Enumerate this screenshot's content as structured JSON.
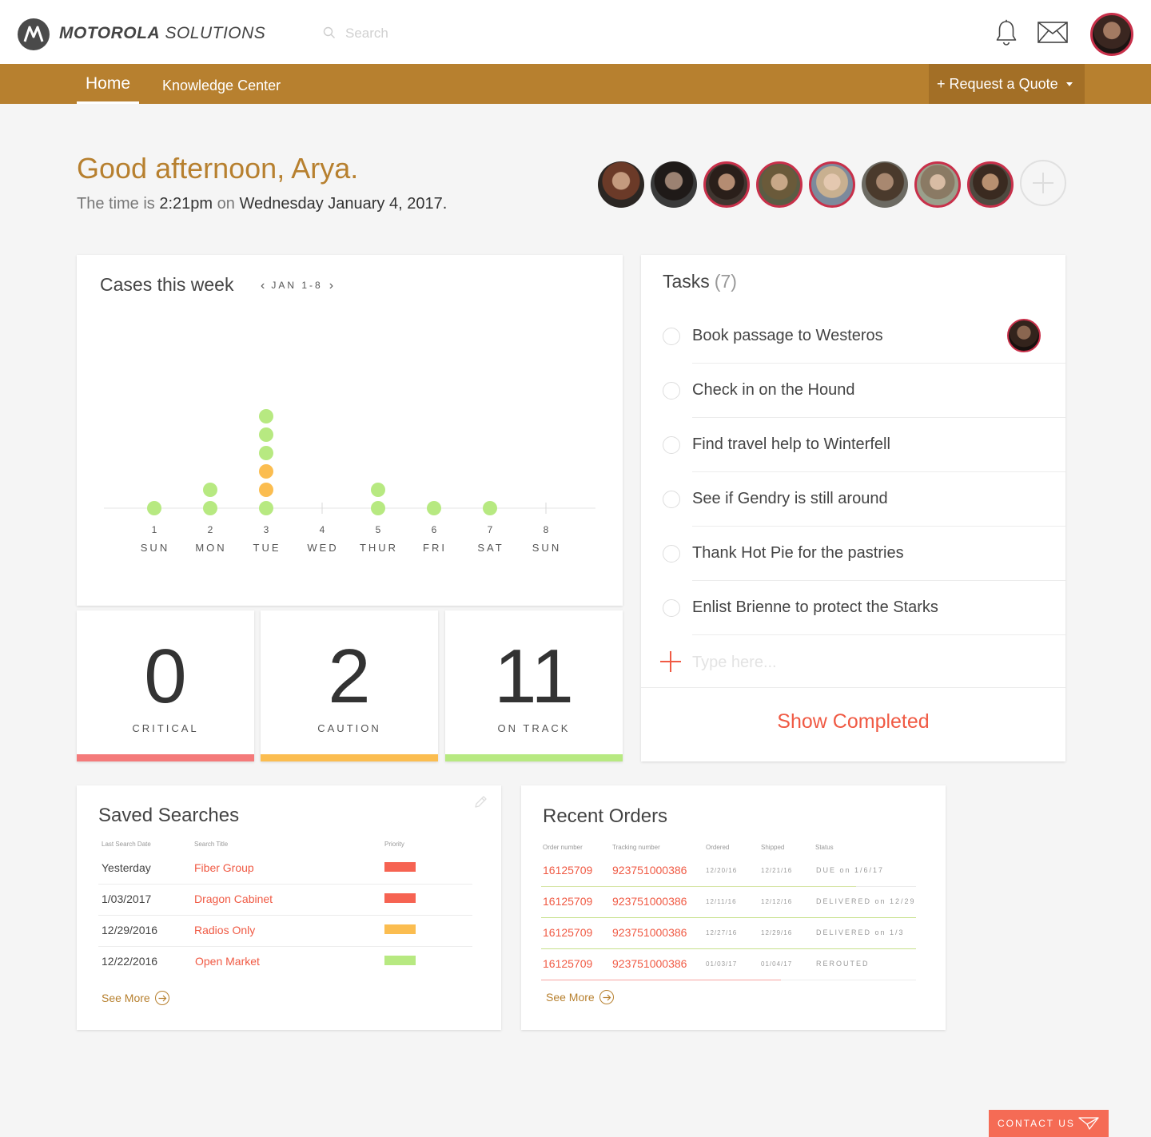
{
  "header": {
    "brand_bold": "MOTOROLA",
    "brand_light": "SOLUTIONS",
    "search_placeholder": "Search",
    "icons": [
      "motorola-logo-icon",
      "search-icon",
      "bell-icon",
      "mail-icon"
    ]
  },
  "nav": {
    "home": "Home",
    "knowledge_center": "Knowledge Center",
    "request_quote": "+ Request a Quote"
  },
  "greeting": {
    "title": "Good afternoon, Arya.",
    "time_prefix": "The time is",
    "time": "2:21pm",
    "on": "on",
    "date": "Wednesday January 4, 2017."
  },
  "cases": {
    "title": "Cases this week",
    "range": "JAN 1-8",
    "chart_data": {
      "type": "scatter",
      "categories": [
        {
          "num": "1",
          "day": "SUN"
        },
        {
          "num": "2",
          "day": "MON"
        },
        {
          "num": "3",
          "day": "TUE"
        },
        {
          "num": "4",
          "day": "WED"
        },
        {
          "num": "5",
          "day": "THUR"
        },
        {
          "num": "6",
          "day": "FRI"
        },
        {
          "num": "7",
          "day": "SAT"
        },
        {
          "num": "8",
          "day": "SUN"
        }
      ],
      "series": [
        {
          "name": "on track",
          "color": "#b7e981",
          "values": [
            1,
            2,
            4,
            0,
            2,
            1,
            1,
            0
          ]
        },
        {
          "name": "caution",
          "color": "#fbbd50",
          "values": [
            0,
            0,
            2,
            0,
            0,
            0,
            0,
            0
          ]
        },
        {
          "name": "critical",
          "color": "#f47a7a",
          "values": [
            0,
            0,
            0,
            0,
            0,
            0,
            0,
            0
          ]
        }
      ],
      "stack_order": [
        "caution",
        "on track"
      ]
    }
  },
  "stats": [
    {
      "value": "0",
      "label": "CRITICAL",
      "color": "#f47a7a"
    },
    {
      "value": "2",
      "label": "CAUTION",
      "color": "#fbbd50"
    },
    {
      "value": "11",
      "label": "ON TRACK",
      "color": "#b7e981"
    }
  ],
  "tasks": {
    "title": "Tasks",
    "count": "(7)",
    "items": [
      "Book passage to Westeros",
      "Check in on the Hound",
      "Find travel help to Winterfell",
      "See if Gendry is still around",
      "Thank Hot Pie for the pastries",
      "Enlist Brienne to protect the Starks"
    ],
    "add_placeholder": "Type here...",
    "show_completed": "Show Completed"
  },
  "saved_searches": {
    "title": "Saved Searches",
    "headers": {
      "date": "Last Search Date",
      "title": "Search Title",
      "priority": "Priority"
    },
    "rows": [
      {
        "date": "Yesterday",
        "title": "Fiber Group",
        "priority_color": "#f66352"
      },
      {
        "date": "1/03/2017",
        "title": "Dragon Cabinet",
        "priority_color": "#f66352"
      },
      {
        "date": "12/29/2016",
        "title": "Radios Only",
        "priority_color": "#fbbd50"
      },
      {
        "date": "12/22/2016",
        "title": "Open Market",
        "priority_color": "#b7e981"
      }
    ],
    "see_more": "See More"
  },
  "recent_orders": {
    "title": "Recent Orders",
    "headers": {
      "order": "Order number",
      "tracking": "Tracking number",
      "ordered": "Ordered",
      "shipped": "Shipped",
      "status": "Status"
    },
    "rows": [
      {
        "order": "16125709",
        "tracking": "923751000386",
        "ordered": "12/20/16",
        "shipped": "12/21/16",
        "status": "DUE on 1/6/17",
        "progress": 0.84,
        "progress_color": "#d8e6a8"
      },
      {
        "order": "16125709",
        "tracking": "923751000386",
        "ordered": "12/11/16",
        "shipped": "12/12/16",
        "status": "DELIVERED on 12/29",
        "progress": 1.0,
        "progress_color": "#c6e08a"
      },
      {
        "order": "16125709",
        "tracking": "923751000386",
        "ordered": "12/27/16",
        "shipped": "12/29/16",
        "status": "DELIVERED on 1/3",
        "progress": 1.0,
        "progress_color": "#c6e08a"
      },
      {
        "order": "16125709",
        "tracking": "923751000386",
        "ordered": "01/03/17",
        "shipped": "01/04/17",
        "status": "REROUTED",
        "progress": 0.64,
        "progress_color": "#f6a3a0"
      }
    ],
    "see_more": "See More"
  },
  "contact": "CONTACT US"
}
